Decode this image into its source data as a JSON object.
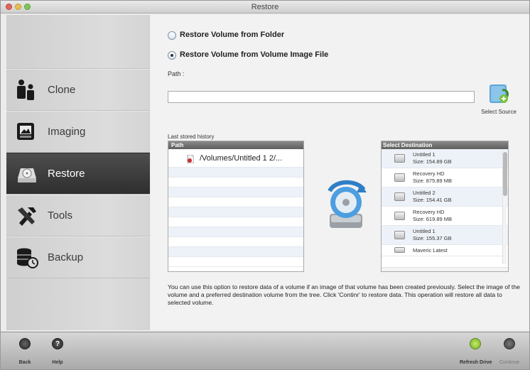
{
  "window": {
    "title": "Restore"
  },
  "sidebar": {
    "items": [
      {
        "label": "Clone",
        "icon": "clone-icon",
        "active": false
      },
      {
        "label": "Imaging",
        "icon": "imaging-icon",
        "active": false
      },
      {
        "label": "Restore",
        "icon": "restore-icon",
        "active": true
      },
      {
        "label": "Tools",
        "icon": "tools-icon",
        "active": false
      },
      {
        "label": "Backup",
        "icon": "backup-icon",
        "active": false
      }
    ]
  },
  "restore": {
    "option_folder": "Restore Volume from Folder",
    "option_image": "Restore Volume from Volume Image File",
    "selected_option": "image",
    "path_label": "Path :",
    "path_value": "",
    "select_source_label": "Select Source",
    "history_label": "Last stored history",
    "history_header": "Path",
    "history_items": [
      "/Volumes/Untitled 1 2/..."
    ],
    "destination_header": "Select Destination",
    "destinations": [
      {
        "name": "Untitled 1",
        "size": "Size: 154.89 GB"
      },
      {
        "name": "Recovery HD",
        "size": "Size: 875.89 MB"
      },
      {
        "name": "Untitled 2",
        "size": "Size: 154.41 GB"
      },
      {
        "name": "Recovery HD",
        "size": "Size: 619.89 MB"
      },
      {
        "name": "Untitled 1",
        "size": "Size: 155.37 GB"
      },
      {
        "name": "Maveric Latest",
        "size": ""
      }
    ],
    "description": "You can use this option to restore data of a volume if an image of that volume has been created previously. Select the image of the volume and a preferred destination volume from the tree. Click 'Continr' to restore data. This operation will restore all data to selected volume."
  },
  "toolbar": {
    "back_label": "Back",
    "help_label": "Help",
    "refresh_label": "Refresh Drive",
    "continue_label": "Continue"
  },
  "colors": {
    "sidebar_active": "#333333",
    "refresh_green": "#8cc63f",
    "list_header": "#6e6e6e"
  }
}
